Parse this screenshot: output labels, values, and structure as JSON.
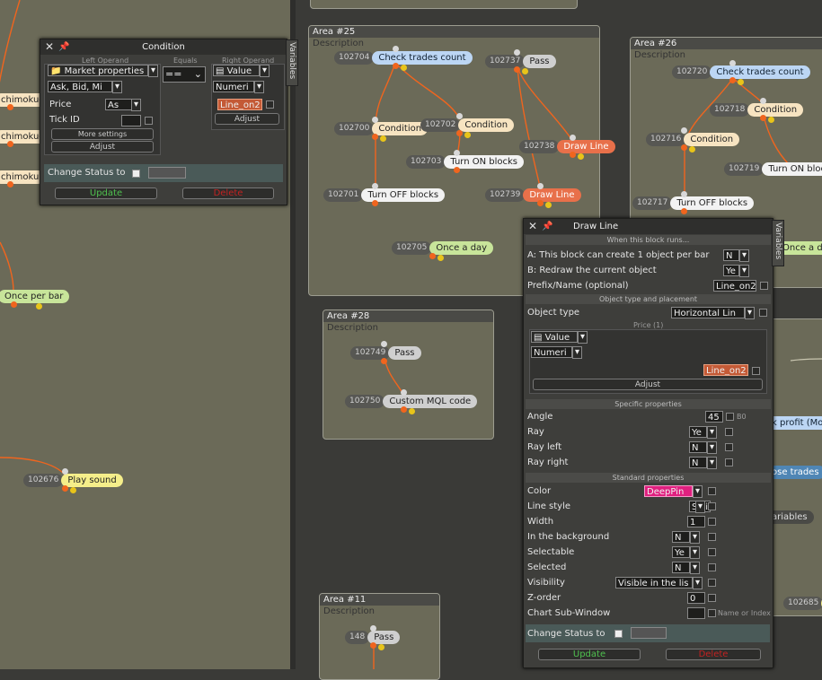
{
  "colors": {
    "canvas": "#6b6a58",
    "background": "#3a3a37",
    "panel": "#3e3e3b",
    "link": "#f0651e",
    "accent_red": "#e8704a",
    "deep_pink": "#e0207f"
  },
  "left_canvas": {
    "nodes": {
      "ichimoku_a": "chimoku-A",
      "ichimoku_b": "chimoku-B",
      "ichimoku": "chimoku",
      "once_per_bar": "Once per bar",
      "play_sound_id": "102676",
      "play_sound": "Play sound"
    }
  },
  "areas": {
    "a25": {
      "title": "Area #25",
      "desc": "Description",
      "nodes": [
        {
          "id": "102704",
          "label": "Check trades count"
        },
        {
          "id": "102737",
          "label": "Pass"
        },
        {
          "id": "102700",
          "label": "Condition"
        },
        {
          "id": "102702",
          "label": "Condition"
        },
        {
          "id": "102738",
          "label": "Draw Line"
        },
        {
          "id": "102703",
          "label": "Turn ON blocks"
        },
        {
          "id": "102701",
          "label": "Turn OFF blocks"
        },
        {
          "id": "102739",
          "label": "Draw Line"
        },
        {
          "id": "102705",
          "label": "Once a day"
        }
      ]
    },
    "a26": {
      "title": "Area #26",
      "desc": "Description",
      "nodes": [
        {
          "id": "102720",
          "label": "Check trades count"
        },
        {
          "id": "102718",
          "label": "Condition"
        },
        {
          "id": "102716",
          "label": "Condition"
        },
        {
          "id": "102719",
          "label": "Turn ON blocks"
        },
        {
          "id": "102717",
          "label": "Turn OFF blocks"
        }
      ],
      "partial": {
        "once": "Once a d"
      }
    },
    "a28": {
      "title": "Area #28",
      "desc": "Description",
      "nodes": [
        {
          "id": "102749",
          "label": "Pass"
        },
        {
          "id": "102750",
          "label": "Custom MQL code"
        }
      ]
    },
    "a11": {
      "title": "Area #11",
      "desc": "Description",
      "nodes": [
        {
          "id": "148",
          "label": "Pass"
        }
      ]
    }
  },
  "right_partial": {
    "profit": "k profit (Mo",
    "close_trades": "ose trades",
    "variables": "ariables",
    "id_102685": "102685"
  },
  "condition_panel": {
    "title": "Condition",
    "vtab": "Variables",
    "left_operand": "Left Operand",
    "equals": "Equals",
    "right_operand": "Right Operand",
    "market_props": "Market properties",
    "ask_bid": "Ask, Bid, Mi",
    "operator": "==",
    "value": "Value",
    "numeric": "Numeri",
    "line_var": "Line_on2",
    "price_label": "Price",
    "price_val": "As",
    "tick_label": "Tick ID",
    "more_settings": "More settings",
    "adjust_left": "Adjust",
    "adjust_right": "Adjust",
    "change_status": "Change Status to",
    "update": "Update",
    "delete": "Delete"
  },
  "drawline_panel": {
    "title": "Draw Line",
    "vtab": "Variables",
    "sec_runs": "When this block runs...",
    "a_label": "A: This block can create 1 object per bar",
    "a_val": "N",
    "b_label": "B: Redraw the current object",
    "b_val": "Ye",
    "prefix_label": "Prefix/Name (optional)",
    "prefix_val": "Line_on2",
    "sec_obj": "Object type and placement",
    "objtype_label": "Object type",
    "objtype_val": "Horizontal Lin",
    "price_sec": "Price (1)",
    "value": "Value",
    "numeric": "Numeri",
    "line_var": "Line_on2",
    "adjust": "Adjust",
    "sec_specific": "Specific properties",
    "angle_label": "Angle",
    "angle_val": "45",
    "angle_hint": "B0",
    "ray_label": "Ray",
    "ray_val": "Ye",
    "rayleft_label": "Ray left",
    "rayleft_val": "N",
    "rayright_label": "Ray right",
    "rayright_val": "N",
    "sec_standard": "Standard properties",
    "color_label": "Color",
    "color_val": "DeepPin",
    "linestyle_label": "Line style",
    "linestyle_val": "Soli",
    "width_label": "Width",
    "width_val": "1",
    "bg_label": "In the background",
    "bg_val": "N",
    "selectable_label": "Selectable",
    "selectable_val": "Ye",
    "selected_label": "Selected",
    "selected_val": "N",
    "visibility_label": "Visibility",
    "visibility_val": "Visible in the lis",
    "zorder_label": "Z-order",
    "zorder_val": "0",
    "subwin_label": "Chart Sub-Window",
    "subwin_hint": "Name or Index",
    "change_status": "Change Status to",
    "update": "Update",
    "delete": "Delete"
  }
}
